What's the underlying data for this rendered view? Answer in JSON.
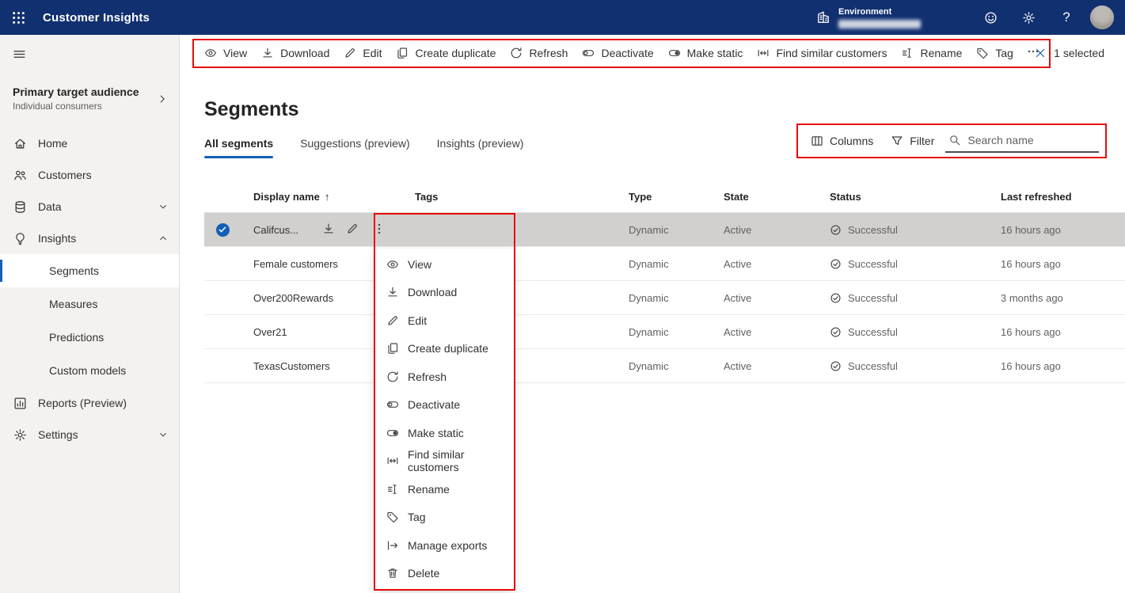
{
  "topbar": {
    "app_title": "Customer Insights",
    "environment_label": "Environment",
    "help_label": "?"
  },
  "sidebar": {
    "audience_title": "Primary target audience",
    "audience_subtitle": "Individual consumers",
    "items": [
      {
        "label": "Home",
        "icon": "home"
      },
      {
        "label": "Customers",
        "icon": "people"
      },
      {
        "label": "Data",
        "icon": "database",
        "chevron": "down"
      },
      {
        "label": "Insights",
        "icon": "lightbulb",
        "chevron": "up"
      },
      {
        "label": "Reports (Preview)",
        "icon": "chart"
      },
      {
        "label": "Settings",
        "icon": "gear",
        "chevron": "down"
      }
    ],
    "insights_subitems": [
      {
        "label": "Segments",
        "selected": true
      },
      {
        "label": "Measures"
      },
      {
        "label": "Predictions"
      },
      {
        "label": "Custom models"
      }
    ]
  },
  "toolbar": {
    "commands": [
      {
        "label": "View",
        "icon": "eye"
      },
      {
        "label": "Download",
        "icon": "download"
      },
      {
        "label": "Edit",
        "icon": "pencil"
      },
      {
        "label": "Create duplicate",
        "icon": "copy"
      },
      {
        "label": "Refresh",
        "icon": "refresh"
      },
      {
        "label": "Deactivate",
        "icon": "toggle-left"
      },
      {
        "label": "Make static",
        "icon": "toggle-right"
      },
      {
        "label": "Find similar customers",
        "icon": "similar"
      },
      {
        "label": "Rename",
        "icon": "rename"
      },
      {
        "label": "Tag",
        "icon": "tag"
      }
    ],
    "selection_label": "1 selected"
  },
  "page": {
    "title": "Segments",
    "tabs": [
      {
        "label": "All segments",
        "active": true
      },
      {
        "label": "Suggestions (preview)"
      },
      {
        "label": "Insights (preview)"
      }
    ]
  },
  "view_controls": {
    "columns_label": "Columns",
    "filter_label": "Filter",
    "search_placeholder": "Search name"
  },
  "table": {
    "headers": {
      "display_name": "Display name",
      "tags": "Tags",
      "type": "Type",
      "state": "State",
      "status": "Status",
      "last_refreshed": "Last refreshed"
    },
    "sort_indicator": "↑",
    "rows": [
      {
        "name": "Califcus...",
        "tags": "",
        "type": "Dynamic",
        "state": "Active",
        "status": "Successful",
        "last_refreshed": "16 hours ago"
      },
      {
        "name": "Female customers",
        "tags": "",
        "type": "Dynamic",
        "state": "Active",
        "status": "Successful",
        "last_refreshed": "16 hours ago"
      },
      {
        "name": "Over200Rewards",
        "tags": "",
        "type": "Dynamic",
        "state": "Active",
        "status": "Successful",
        "last_refreshed": "3 months ago"
      },
      {
        "name": "Over21",
        "tags": "",
        "type": "Dynamic",
        "state": "Active",
        "status": "Successful",
        "last_refreshed": "16 hours ago"
      },
      {
        "name": "TexasCustomers",
        "tags": "",
        "type": "Dynamic",
        "state": "Active",
        "status": "Successful",
        "last_refreshed": "16 hours ago"
      }
    ]
  },
  "context_menu": {
    "items": [
      {
        "label": "View",
        "icon": "eye"
      },
      {
        "label": "Download",
        "icon": "download"
      },
      {
        "label": "Edit",
        "icon": "pencil"
      },
      {
        "label": "Create duplicate",
        "icon": "copy"
      },
      {
        "label": "Refresh",
        "icon": "refresh"
      },
      {
        "label": "Deactivate",
        "icon": "toggle-left"
      },
      {
        "label": "Make static",
        "icon": "toggle-right"
      },
      {
        "label": "Find similar customers",
        "icon": "similar"
      },
      {
        "label": "Rename",
        "icon": "rename"
      },
      {
        "label": "Tag",
        "icon": "tag"
      },
      {
        "label": "Manage exports",
        "icon": "export"
      },
      {
        "label": "Delete",
        "icon": "trash"
      }
    ]
  },
  "colors": {
    "topbar_bg": "#113070",
    "accent": "#1160b7",
    "annotation_red": "#e60a0a",
    "selected_row_bg": "#d2d0ce"
  }
}
